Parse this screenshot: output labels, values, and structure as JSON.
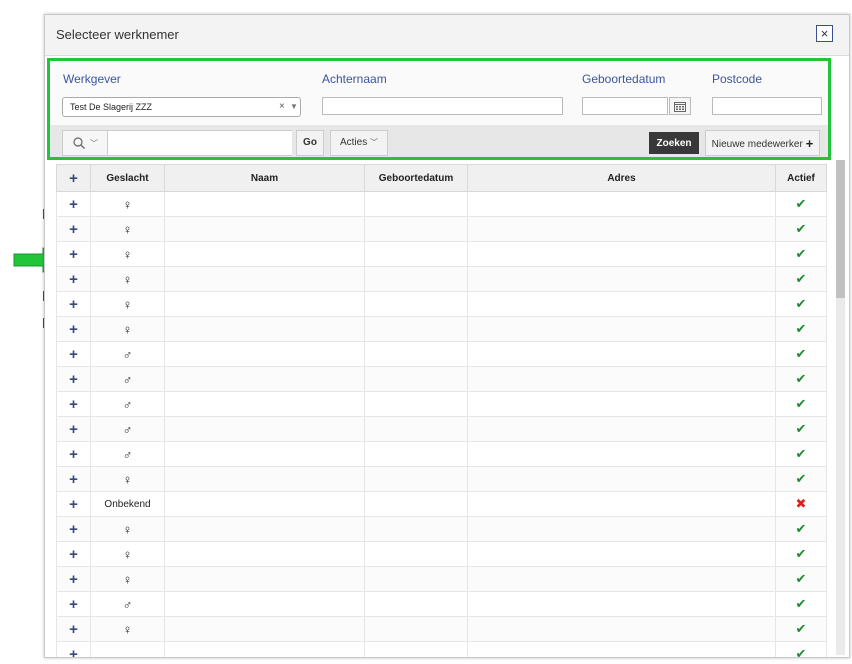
{
  "dialog": {
    "title": "Selecteer werknemer",
    "close_glyph": "×"
  },
  "filters": {
    "werkgever_label": "Werkgever",
    "werkgever_value": "Test De Slagerij ZZZ",
    "clear_glyph": "×",
    "achternaam_label": "Achternaam",
    "achternaam_value": "",
    "geboortedatum_label": "Geboortedatum",
    "geboortedatum_value": "",
    "postcode_label": "Postcode",
    "postcode_value": ""
  },
  "toolbar": {
    "search_value": "",
    "go_label": "Go",
    "acties_label": "Acties",
    "zoeken_label": "Zoeken",
    "nieuw_label": "Nieuwe medewerker"
  },
  "table": {
    "headers": {
      "plus": "+",
      "geslacht": "Geslacht",
      "naam": "Naam",
      "geboortedatum": "Geboortedatum",
      "adres": "Adres",
      "actief": "Actief"
    },
    "rows": [
      {
        "plus": "+",
        "geslacht": "♀",
        "naam": "",
        "geboortedatum": "",
        "adres": "",
        "actief": "✔"
      },
      {
        "plus": "+",
        "geslacht": "♀",
        "naam": "",
        "geboortedatum": "",
        "adres": "",
        "actief": "✔"
      },
      {
        "plus": "+",
        "geslacht": "♀",
        "naam": "",
        "geboortedatum": "",
        "adres": "",
        "actief": "✔"
      },
      {
        "plus": "+",
        "geslacht": "♀",
        "naam": "",
        "geboortedatum": "",
        "adres": "",
        "actief": "✔"
      },
      {
        "plus": "+",
        "geslacht": "♀",
        "naam": "",
        "geboortedatum": "",
        "adres": "",
        "actief": "✔"
      },
      {
        "plus": "+",
        "geslacht": "♀",
        "naam": "",
        "geboortedatum": "",
        "adres": "",
        "actief": "✔"
      },
      {
        "plus": "+",
        "geslacht": "♂",
        "naam": "",
        "geboortedatum": "",
        "adres": "",
        "actief": "✔"
      },
      {
        "plus": "+",
        "geslacht": "♂",
        "naam": "",
        "geboortedatum": "",
        "adres": "",
        "actief": "✔"
      },
      {
        "plus": "+",
        "geslacht": "♂",
        "naam": "",
        "geboortedatum": "",
        "adres": "",
        "actief": "✔"
      },
      {
        "plus": "+",
        "geslacht": "♂",
        "naam": "",
        "geboortedatum": "",
        "adres": "",
        "actief": "✔"
      },
      {
        "plus": "+",
        "geslacht": "♂",
        "naam": "",
        "geboortedatum": "",
        "adres": "",
        "actief": "✔"
      },
      {
        "plus": "+",
        "geslacht": "♀",
        "naam": "",
        "geboortedatum": "",
        "adres": "",
        "actief": "✔"
      },
      {
        "plus": "+",
        "geslacht": "Onbekend",
        "naam": "",
        "geboortedatum": "",
        "adres": "",
        "actief": "✖"
      },
      {
        "plus": "+",
        "geslacht": "♀",
        "naam": "",
        "geboortedatum": "",
        "adres": "",
        "actief": "✔"
      },
      {
        "plus": "+",
        "geslacht": "♀",
        "naam": "",
        "geboortedatum": "",
        "adres": "",
        "actief": "✔"
      },
      {
        "plus": "+",
        "geslacht": "♀",
        "naam": "",
        "geboortedatum": "",
        "adres": "",
        "actief": "✔"
      },
      {
        "plus": "+",
        "geslacht": "♂",
        "naam": "",
        "geboortedatum": "",
        "adres": "",
        "actief": "✔"
      },
      {
        "plus": "+",
        "geslacht": "♀",
        "naam": "",
        "geboortedatum": "",
        "adres": "",
        "actief": "✔"
      },
      {
        "plus": "+",
        "geslacht": "",
        "naam": "",
        "geboortedatum": "",
        "adres": "",
        "actief": "✔"
      }
    ]
  },
  "colors": {
    "highlight_border": "#22c43a",
    "arrow": "#22c43a",
    "active_check": "#1e8a2e",
    "inactive_cross": "#e02020",
    "label_blue": "#3a55a0"
  }
}
